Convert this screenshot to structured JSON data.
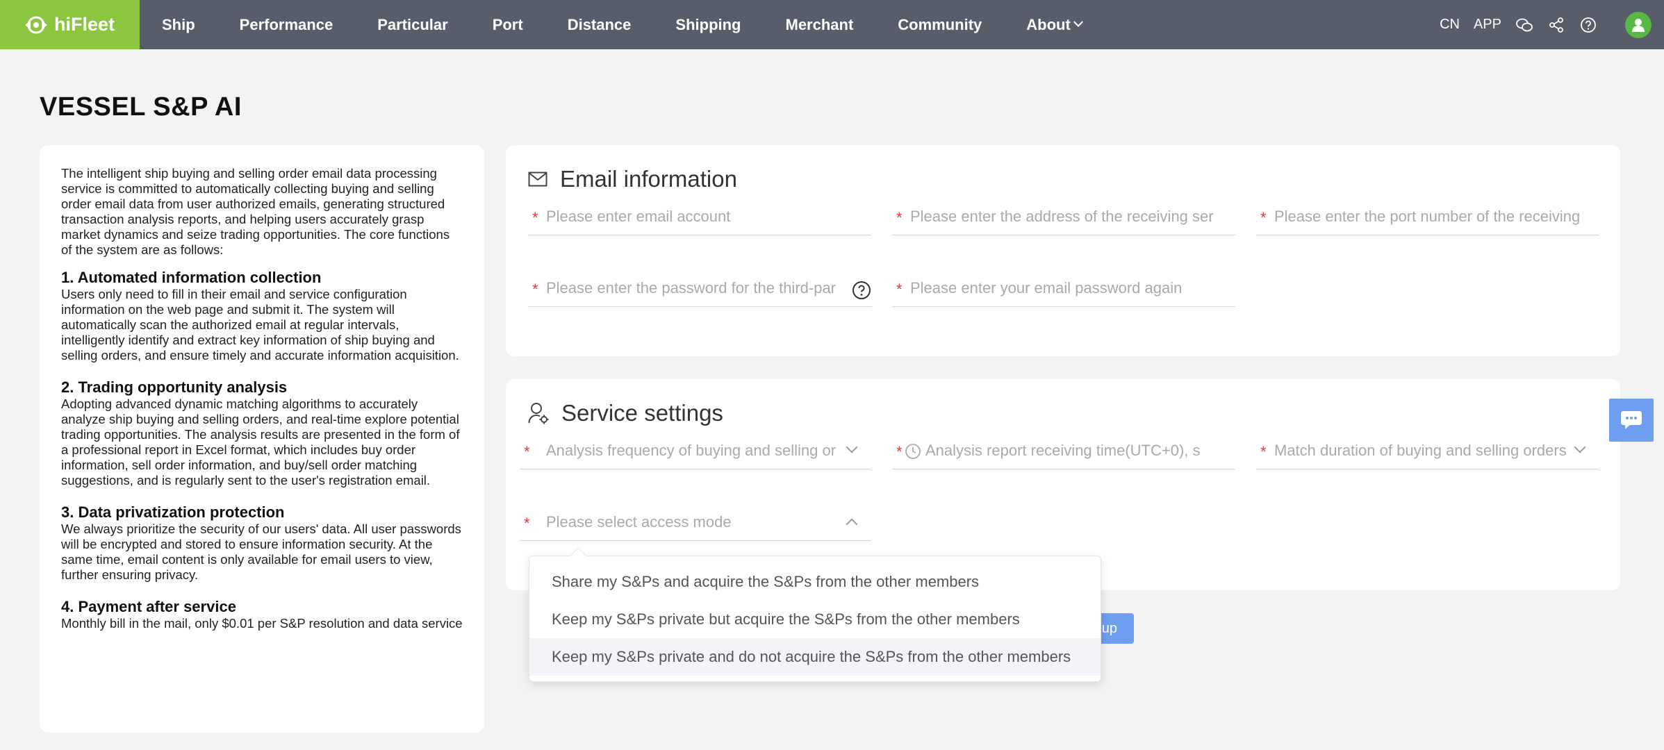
{
  "nav": {
    "brand": "hiFleet",
    "items": [
      "Ship",
      "Performance",
      "Particular",
      "Port",
      "Distance",
      "Shipping",
      "Merchant",
      "Community",
      "About"
    ],
    "right": {
      "cn": "CN",
      "app": "APP"
    }
  },
  "page": {
    "title": "VESSEL S&P AI"
  },
  "info": {
    "intro": "The intelligent ship buying and selling order email data processing service is committed to automatically collecting buying and selling order email data from user authorized emails, generating structured transaction analysis reports, and helping users accurately grasp market dynamics and seize trading opportunities. The core functions of the system are as follows:",
    "sections": [
      {
        "title": "1. Automated information collection",
        "body": "Users only need to fill in their email and service configuration information on the web page and submit it. The system will automatically scan the authorized email at regular intervals, intelligently identify and extract key information of ship buying and selling orders, and ensure timely and accurate information acquisition."
      },
      {
        "title": "2. Trading opportunity analysis",
        "body": "Adopting advanced dynamic matching algorithms to accurately analyze ship buying and selling orders, and real-time explore potential trading opportunities. The analysis results are presented in the form of a professional report in Excel format, which includes buy order information, sell order information, and buy/sell order matching suggestions, and is regularly sent to the user's registration email."
      },
      {
        "title": "3. Data privatization protection",
        "body": "We always prioritize the security of our users' data. All user passwords will be encrypted and stored to ensure information security. At the same time, email content is only available for email users to view, further ensuring privacy."
      },
      {
        "title": "4. Payment after service",
        "body": "Monthly bill in the mail, only $0.01 per S&P resolution and data service"
      }
    ]
  },
  "email": {
    "title": "Email information",
    "fields": {
      "account": "Please enter email account",
      "server": "Please enter the address of the receiving ser",
      "port": "Please enter the port number of the receiving",
      "password": "Please enter the password for the third-par",
      "confirm": "Please enter your email password again"
    }
  },
  "service": {
    "title": "Service settings",
    "fields": {
      "frequency": "Analysis frequency of buying and selling or",
      "time": "Analysis report receiving time(UTC+0), s",
      "duration": "Match duration of buying and selling orders",
      "access": "Please select access mode"
    },
    "options": [
      "Share my S&Ps and acquire the S&Ps from the other members",
      "Keep my S&Ps private but acquire the S&Ps from the other members",
      "Keep my S&Ps private and do not acquire the S&Ps from the other members"
    ],
    "submit_fragment": "up"
  },
  "required_mark": "*",
  "colors": {
    "brand": "#8cc63f",
    "nav_bg": "#575d69",
    "primary": "#6e9ef0",
    "required": "#e53935"
  }
}
